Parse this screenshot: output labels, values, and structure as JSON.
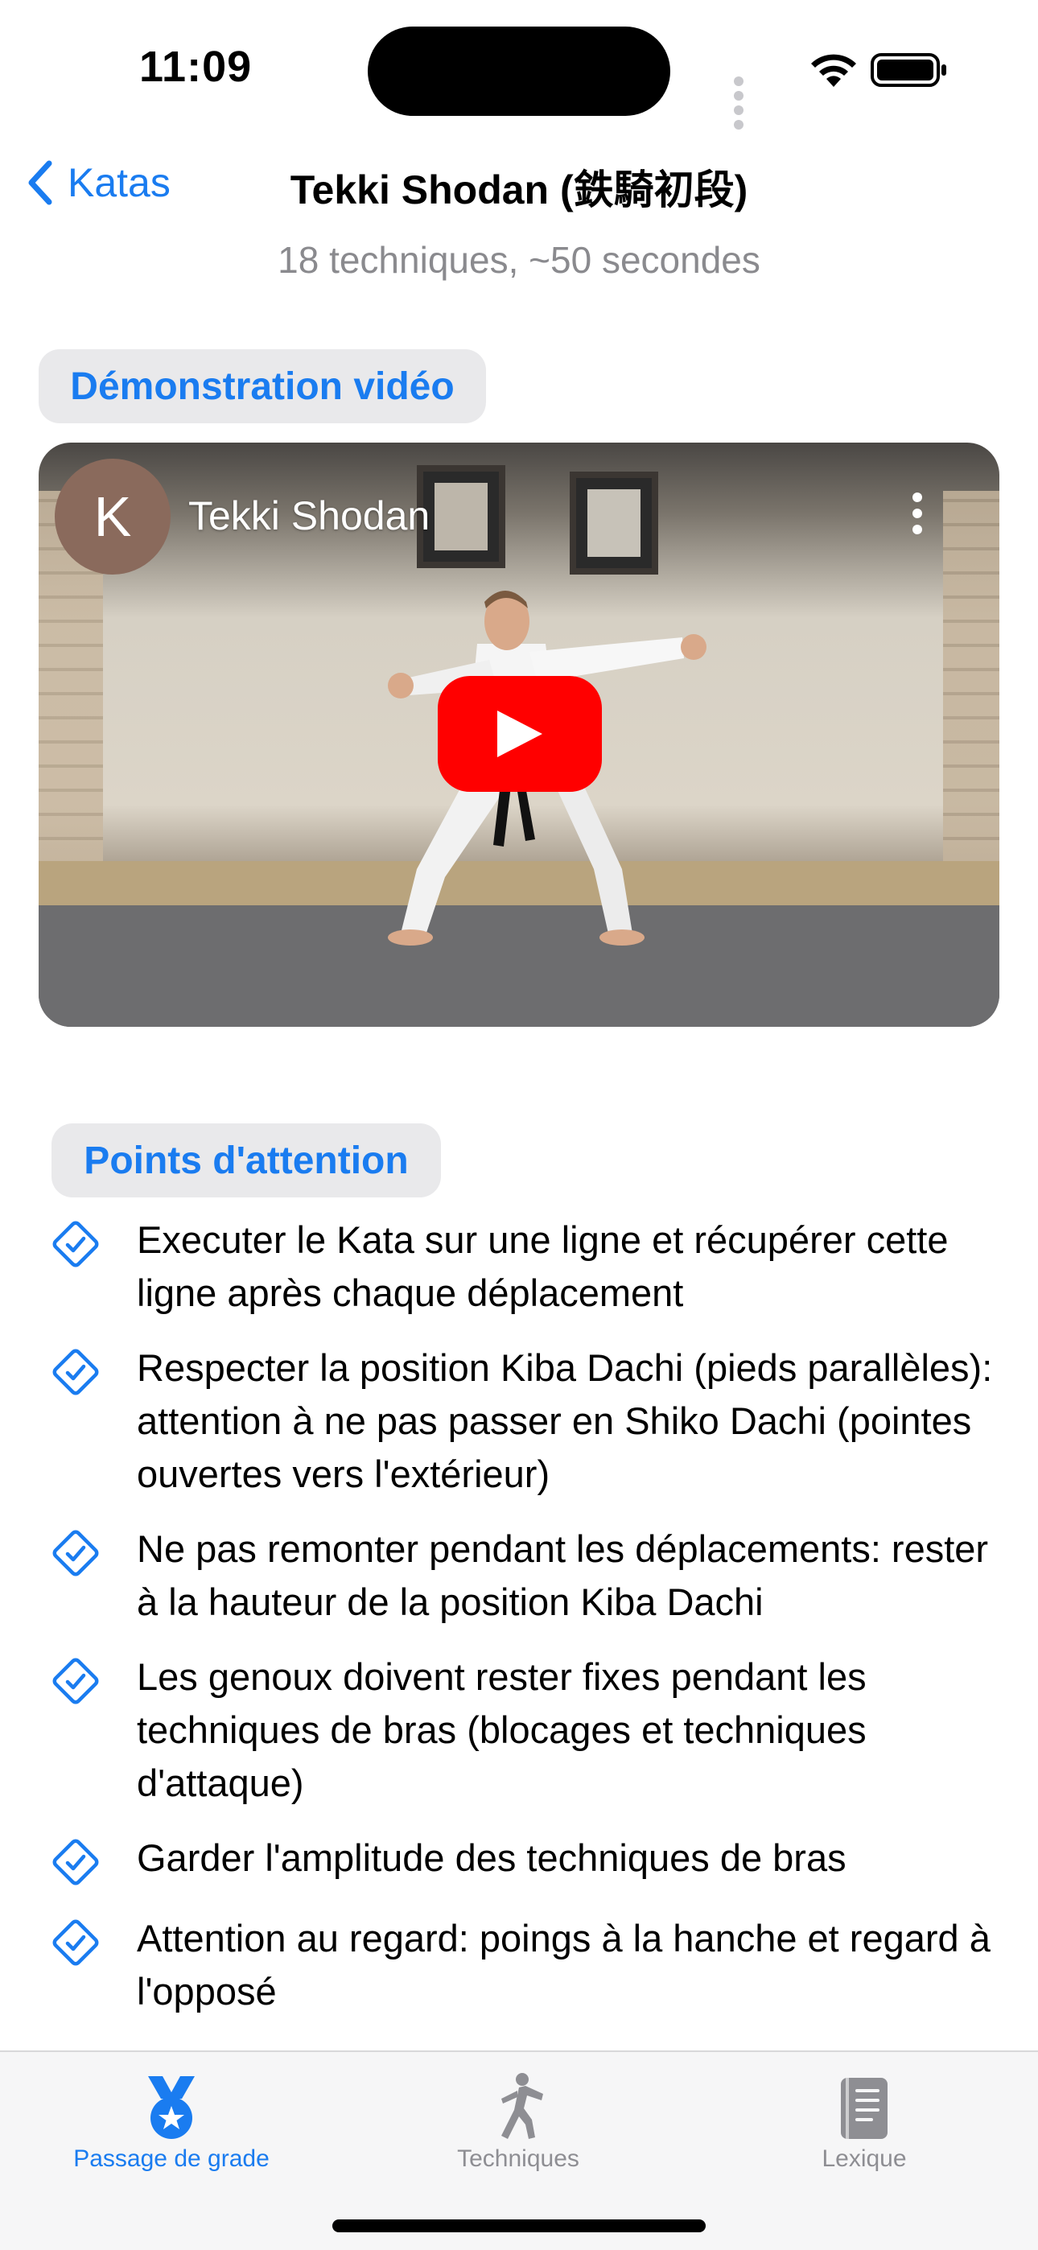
{
  "status_bar": {
    "time": "11:09"
  },
  "nav": {
    "back_label": "Katas",
    "title": "Tekki Shodan (鉄騎初段)",
    "subtitle": "18 techniques, ~50 secondes"
  },
  "video_section": {
    "heading": "Démonstration vidéo",
    "channel_initial": "K",
    "video_title": "Tekki Shodan"
  },
  "points_section": {
    "heading": "Points d'attention",
    "items": [
      "Executer le Kata sur une ligne et récupérer cette ligne après chaque déplacement",
      "Respecter la position Kiba Dachi (pieds parallèles): attention à ne pas passer en Shiko Dachi (pointes ouvertes vers l'extérieur)",
      "Ne pas remonter pendant les déplacements: rester à la hauteur de la position Kiba Dachi",
      "Les genoux doivent rester fixes pendant les techniques de bras (blocages et techniques d'attaque)",
      "Garder l'amplitude des techniques de bras",
      "Attention au regard: poings à la hanche et regard à l'opposé"
    ]
  },
  "tab_bar": {
    "items": [
      {
        "label": "Passage de grade",
        "icon": "medal-icon",
        "selected": true
      },
      {
        "label": "Techniques",
        "icon": "figure-kick-icon",
        "selected": false
      },
      {
        "label": "Lexique",
        "icon": "book-icon",
        "selected": false
      }
    ]
  },
  "colors": {
    "accent": "#1a7cf0",
    "inactive": "#8e8e93",
    "play_button": "#ff0000"
  }
}
